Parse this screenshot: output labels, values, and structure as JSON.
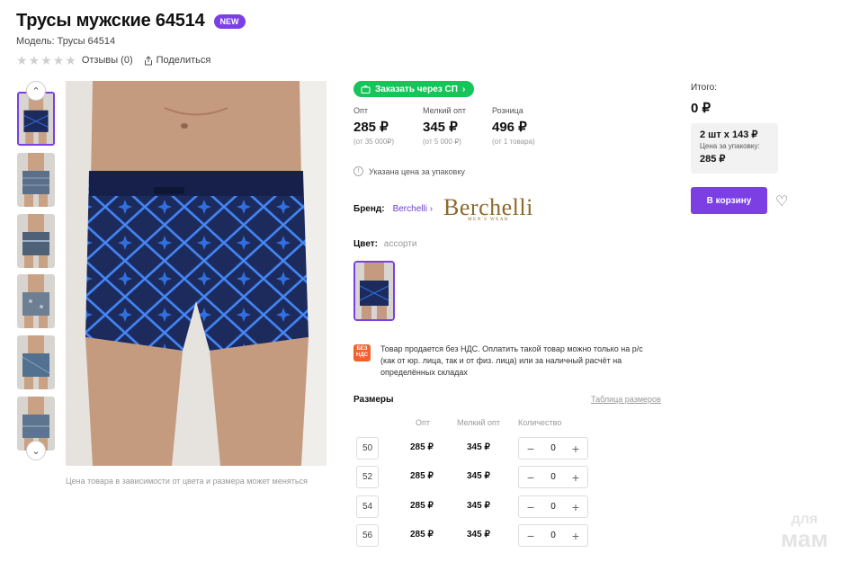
{
  "product": {
    "title": "Трусы мужские 64514",
    "badge": "NEW",
    "model": "Модель: Трусы 64514",
    "reviews": "Отзывы (0)",
    "share": "Поделиться",
    "rating": 0,
    "rating_max": 5
  },
  "gallery": {
    "caption": "Цена товара в зависимости от цвета и размера может меняться",
    "thumb_count": 6,
    "selected_thumb": 1
  },
  "order_sp": "Заказать через СП",
  "prices": [
    {
      "label": "Опт",
      "value": "285 ₽",
      "sub": "(от 35 000₽)"
    },
    {
      "label": "Мелкий опт",
      "value": "345 ₽",
      "sub": "(от 5 000 ₽)"
    },
    {
      "label": "Розница",
      "value": "496 ₽",
      "sub": "(от 1 товара)"
    }
  ],
  "pack_note": "Указана цена за упаковку",
  "brand": {
    "label": "Бренд:",
    "name": "Berchelli",
    "logo_text": "Berchelli",
    "logo_sub": "MEN'S WEAR"
  },
  "color": {
    "label": "Цвет:",
    "value": "ассорти"
  },
  "nds": {
    "badge": "БЕЗ НДС",
    "text": "Товар продается без НДС. Оплатить такой товар можно только на р/с (как от юр. лица, так и от физ. лица) или за наличный расчёт на определённых складах"
  },
  "sizes": {
    "title": "Размеры",
    "table_link": "Таблица размеров",
    "headers": {
      "opt": "Опт",
      "small_opt": "Мелкий опт",
      "qty": "Количество"
    },
    "rows": [
      {
        "size": "50",
        "opt": "285 ₽",
        "small_opt": "345 ₽",
        "qty": "0"
      },
      {
        "size": "52",
        "opt": "285 ₽",
        "small_opt": "345 ₽",
        "qty": "0"
      },
      {
        "size": "54",
        "opt": "285 ₽",
        "small_opt": "345 ₽",
        "qty": "0"
      },
      {
        "size": "56",
        "opt": "285 ₽",
        "small_opt": "345 ₽",
        "qty": "0"
      }
    ]
  },
  "summary": {
    "total_label": "Итого:",
    "total_value": "0 ₽",
    "pack_main": "2 шт х 143 ₽",
    "pack_sub": "Цена за упаковку:",
    "pack_price": "285 ₽",
    "cart_button": "В корзину"
  },
  "watermark": {
    "line1": "для",
    "line2": "мам"
  },
  "colors": {
    "accent": "#7b3fe4",
    "green": "#17c45a",
    "nds_orange": "#f0612d",
    "fabric": "#1d2a5c",
    "pattern": "#2f6fe0"
  }
}
